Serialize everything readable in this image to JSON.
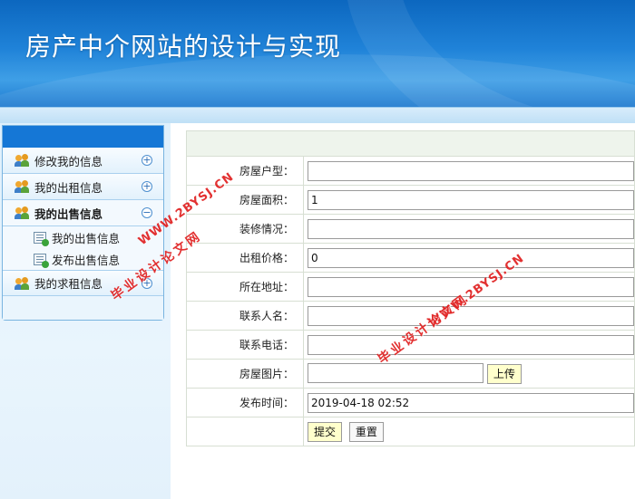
{
  "header": {
    "title": "房产中介网站的设计与实现"
  },
  "menu": {
    "items": [
      {
        "label": "修改我的信息",
        "toggle": "+"
      },
      {
        "label": "我的出租信息",
        "toggle": "+"
      },
      {
        "label": "我的出售信息",
        "toggle": "−",
        "sub": [
          {
            "label": "我的出售信息"
          },
          {
            "label": "发布出售信息"
          }
        ]
      },
      {
        "label": "我的求租信息",
        "toggle": "+"
      }
    ]
  },
  "form": {
    "fields": [
      {
        "label": "房屋户型：",
        "value": ""
      },
      {
        "label": "房屋面积：",
        "value": "1"
      },
      {
        "label": "装修情况：",
        "value": ""
      },
      {
        "label": "出租价格：",
        "value": "0"
      },
      {
        "label": "所在地址：",
        "value": ""
      },
      {
        "label": "联系人名：",
        "value": ""
      },
      {
        "label": "联系电话：",
        "value": ""
      },
      {
        "label": "房屋图片：",
        "value": "",
        "button": "上传"
      },
      {
        "label": "发布时间：",
        "value": "2019-04-18 02:52"
      }
    ],
    "submit_label": "提交",
    "reset_label": "重置"
  },
  "watermarks": {
    "line1": "毕业设计论文网",
    "line2": "WWW.2BYSJ.CN"
  }
}
